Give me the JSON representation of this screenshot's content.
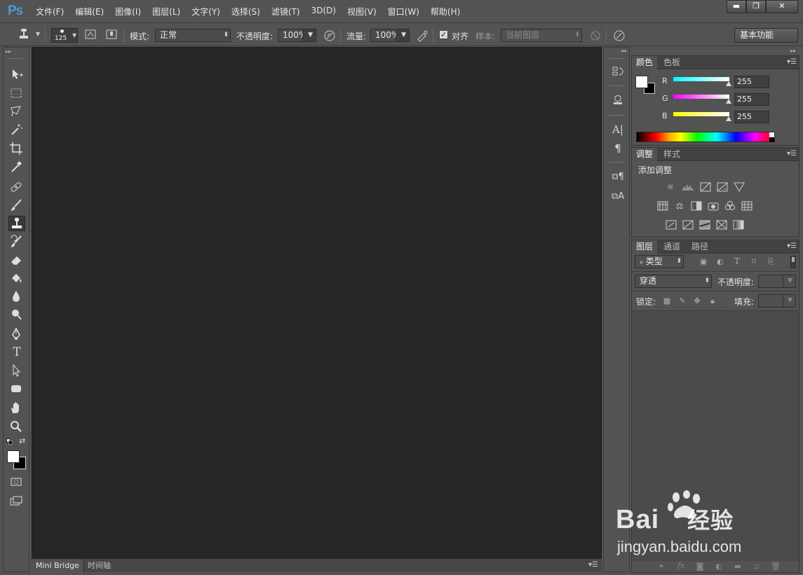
{
  "app": {
    "logo": "Ps"
  },
  "menu": [
    "文件(F)",
    "编辑(E)",
    "图像(I)",
    "图层(L)",
    "文字(Y)",
    "选择(S)",
    "滤镜(T)",
    "3D(D)",
    "视图(V)",
    "窗口(W)",
    "帮助(H)"
  ],
  "window_buttons": {
    "minimize": "▬",
    "maximize": "❐",
    "close": "✕"
  },
  "options": {
    "brush_size": "125",
    "mode_label": "模式:",
    "mode_value": "正常",
    "opacity_label": "不透明度:",
    "opacity_value": "100%",
    "flow_label": "流量:",
    "flow_value": "100%",
    "align_label": "对齐",
    "align_checked": true,
    "sample_label": "样本:",
    "sample_value": "当前图层",
    "workspace": "基本功能"
  },
  "bottom_tabs": [
    "Mini Bridge",
    "时间轴"
  ],
  "color_panel": {
    "tabs": [
      "颜色",
      "色板"
    ],
    "channels": [
      {
        "label": "R",
        "value": "255",
        "color": "#00e5e5"
      },
      {
        "label": "G",
        "value": "255",
        "color": "#e500e5"
      },
      {
        "label": "B",
        "value": "255",
        "color": "#e5e500"
      }
    ]
  },
  "adjust_panel": {
    "tabs": [
      "调整",
      "样式"
    ],
    "title": "添加调整"
  },
  "layers_panel": {
    "tabs": [
      "图层",
      "通道",
      "路径"
    ],
    "filter_label": "类型",
    "blend_value": "穿透",
    "opacity_label": "不透明度:",
    "lock_label": "锁定:",
    "fill_label": "填充:"
  },
  "watermark": {
    "brand": "Bai",
    "brand_cn": "经验",
    "url": "jingyan.baidu.com"
  },
  "colors": {
    "accent": "#4a9ad8",
    "canvas_bg": "#262626",
    "ui_bg": "#535353"
  }
}
